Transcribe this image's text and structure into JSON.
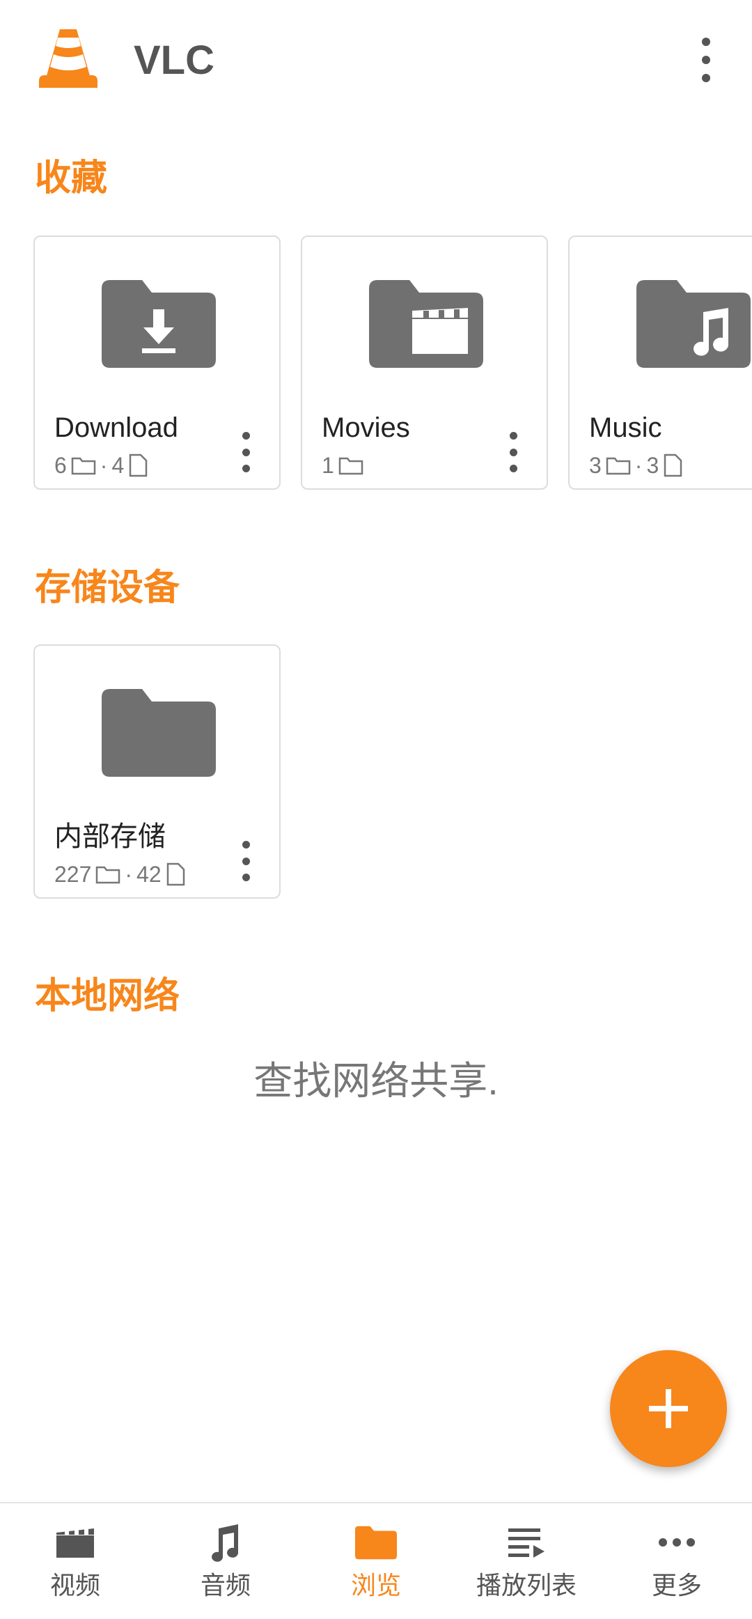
{
  "app": {
    "title": "VLC"
  },
  "colors": {
    "accent": "#f7861b",
    "icon_gray": "#707070",
    "text": "#222222"
  },
  "sections": {
    "favorites": {
      "title": "收藏"
    },
    "storage": {
      "title": "存储设备"
    },
    "network": {
      "title": "本地网络",
      "message": "查找网络共享."
    }
  },
  "favorites": [
    {
      "name": "Download",
      "folders": "6",
      "files": "4",
      "icon": "folder-download-icon"
    },
    {
      "name": "Movies",
      "folders": "1",
      "files": "",
      "icon": "folder-movie-icon"
    },
    {
      "name": "Music",
      "folders": "3",
      "files": "3",
      "icon": "folder-music-icon"
    }
  ],
  "storage": [
    {
      "name": "内部存储",
      "folders": "227",
      "files": "42",
      "icon": "folder-icon"
    }
  ],
  "meta_separator": "·",
  "bottom_nav": [
    {
      "label": "视频",
      "icon": "video-icon",
      "active": false
    },
    {
      "label": "音频",
      "icon": "music-note-icon",
      "active": false
    },
    {
      "label": "浏览",
      "icon": "folder-icon",
      "active": true
    },
    {
      "label": "播放列表",
      "icon": "playlist-icon",
      "active": false
    },
    {
      "label": "更多",
      "icon": "more-horiz-icon",
      "active": false
    }
  ]
}
